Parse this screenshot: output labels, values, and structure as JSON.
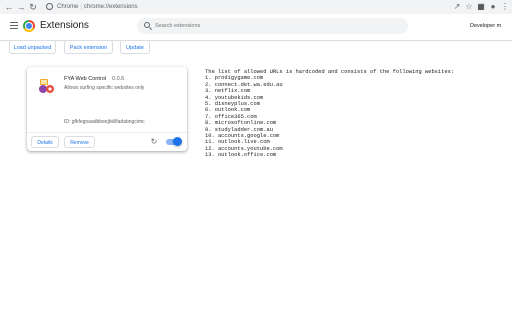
{
  "browser": {
    "site_label": "Chrome",
    "url": "chrome://extensions"
  },
  "page": {
    "title": "Extensions",
    "search_placeholder": "Search extensions",
    "developer_mode_label": "Developer m"
  },
  "toolbar": {
    "load_unpacked": "Load unpacked",
    "pack_extension": "Pack extension",
    "update": "Update"
  },
  "extension": {
    "name": "FYA Web Control",
    "version": "0.0.6",
    "description": "Allows surfing specific websites only",
    "id": "ID: gfkfegoaadbbeejbkllfadabngcimc",
    "details_label": "Details",
    "remove_label": "Remove",
    "enabled": true
  },
  "text_block": {
    "intro": "The list of allowed URLs is hardcoded and consists of the following websites:",
    "items": [
      "1. prodigygame.com",
      "2. connect.det.wa.edu.au",
      "3. netflix.com",
      "4. youtubekids.com",
      "5. disneyplus.com",
      "6. outlook.com",
      "7. office365.com",
      "8. microsoftonline.com",
      "9. studyladder.com.au",
      "10. accounts.google.com",
      "11. outlook.live.com",
      "12. accounts.youtube.com",
      "13. outlook.office.com"
    ]
  },
  "icons": {
    "back": "back-arrow-icon",
    "forward": "forward-arrow-icon",
    "reload": "reload-icon",
    "site": "chrome-site-icon",
    "share": "share-icon",
    "bookmark": "star-icon",
    "puzzle": "extensions-puzzle-icon",
    "profile": "profile-icon",
    "menu": "kebab-menu-icon",
    "hamburger": "hamburger-menu-icon",
    "search": "search-icon"
  },
  "colors": {
    "accent": "#1a73e8",
    "toggle_track": "#8ab4f8",
    "topbar": "#f1f3f4"
  }
}
